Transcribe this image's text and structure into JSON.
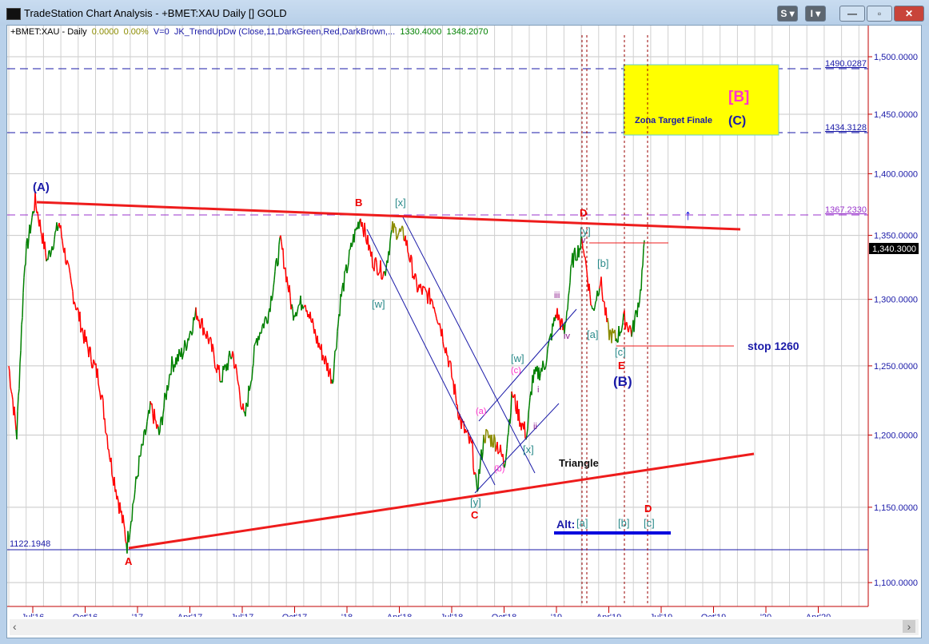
{
  "window": {
    "title": "TradeStation Chart Analysis - +BMET:XAU Daily [] GOLD",
    "s_button": "S ▾",
    "i_button": "I ▾",
    "minimize": "—",
    "maximize": "▫",
    "close": "✕"
  },
  "status": {
    "symbol": "+BMET:XAU - Daily",
    "change": "0.0000",
    "pct": "0.00%",
    "volume": "V=0",
    "indicator": "JK_TrendUpDw (Close,11,DarkGreen,Red,DarkBrown,...",
    "v1": "1330.4000",
    "v2": "1348.2070"
  },
  "price_axis": {
    "ticks": [
      "1,500.0000",
      "1,450.0000",
      "1,400.0000",
      "1,350.0000",
      "1,300.0000",
      "1,250.0000",
      "1,200.0000",
      "1,150.0000",
      "1,100.0000"
    ],
    "last_price": "1,340.3000"
  },
  "time_axis": {
    "ticks": [
      "Jul'16",
      "Oct'16",
      "'17",
      "Apr'17",
      "Jul'17",
      "Oct'17",
      "'18",
      "Apr'18",
      "Jul'18",
      "Oct'18",
      "'19",
      "Apr'19",
      "Jul'19",
      "Oct'19",
      "'20",
      "Apr'20"
    ]
  },
  "levels": {
    "l1490": "1490.0287",
    "l1434": "1434.3128",
    "l1367": "1367.2330",
    "l1122": "1122.1948"
  },
  "annotations": {
    "A_big": "(A)",
    "A": "A",
    "B": "B",
    "x1": "[x]",
    "w1": "[w]",
    "C": "C",
    "y1": "[y]",
    "a_s": "(a)",
    "b_s": "(b)",
    "c_s": "(c)",
    "w2": "[w]",
    "x2": "[x]",
    "i": "i",
    "ii": "ii",
    "iii": "iii",
    "iv": "iv",
    "v": "v",
    "D": "D",
    "y2": "[y]",
    "a_b": "[a]",
    "b_b": "[b]",
    "c_b": "[c]",
    "E": "E",
    "B_big": "(B)",
    "stop": "stop 1260",
    "triangle": "Triangle",
    "alt": "Alt:",
    "alt_a": "[a]",
    "alt_b": "[b]",
    "alt_c": "[c]",
    "alt_D": "D",
    "zona": "Zona Target Finale",
    "C_big": "(C)",
    "B_bracket": "[B]"
  },
  "colors": {
    "up": "#008000",
    "down": "#ff0000",
    "neutral": "#8b8b00",
    "trendline": "#ee1c1c",
    "axis": "#c00000"
  }
}
